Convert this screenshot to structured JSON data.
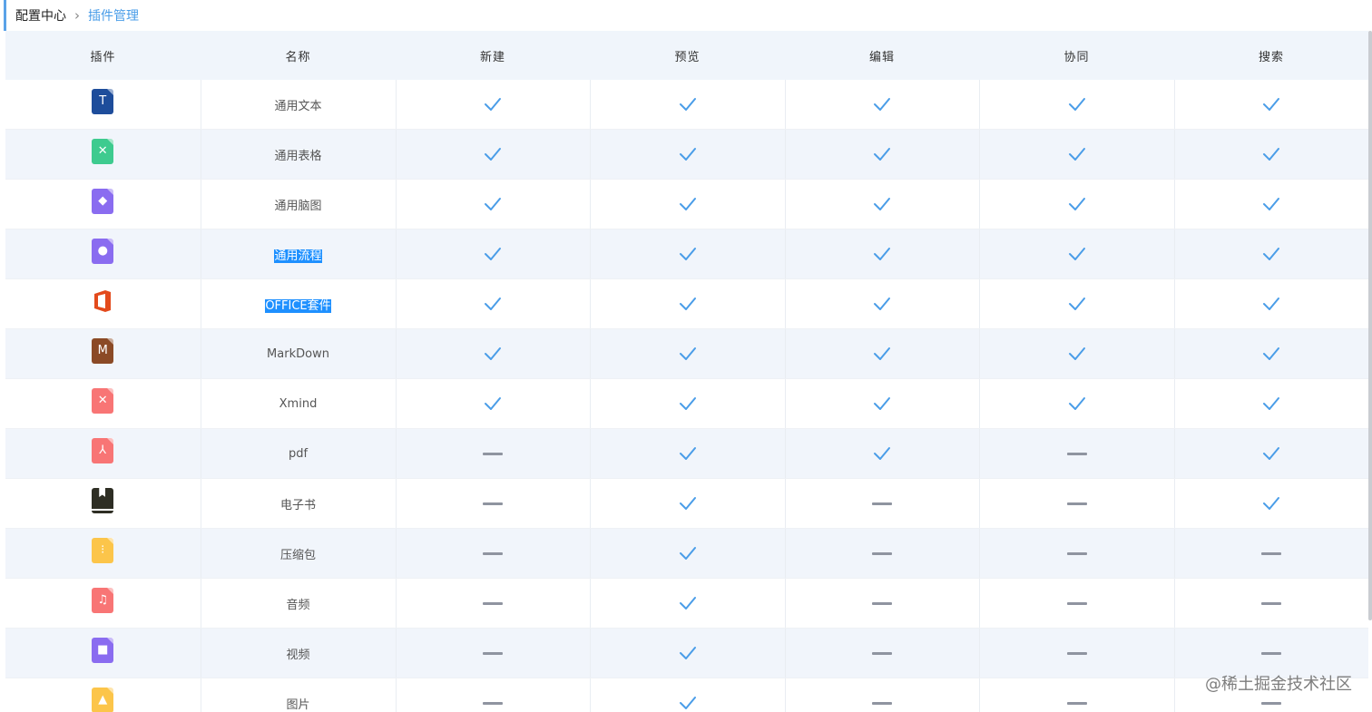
{
  "breadcrumb": {
    "root": "配置中心",
    "separator": "›",
    "current": "插件管理"
  },
  "table": {
    "columns": [
      "插件",
      "名称",
      "新建",
      "预览",
      "编辑",
      "协同",
      "搜索"
    ],
    "rows": [
      {
        "name": "通用文本",
        "icon": "text-doc-icon",
        "color": "#1e4d9b",
        "glyph": "T",
        "selected": false,
        "support": [
          true,
          true,
          true,
          true,
          true
        ]
      },
      {
        "name": "通用表格",
        "icon": "spreadsheet-icon",
        "color": "#3ecb8f",
        "glyph": "✕",
        "selected": false,
        "support": [
          true,
          true,
          true,
          true,
          true
        ]
      },
      {
        "name": "通用脑图",
        "icon": "mindmap-icon",
        "color": "#8a6cf0",
        "glyph": "◆",
        "selected": false,
        "support": [
          true,
          true,
          true,
          true,
          true
        ]
      },
      {
        "name": "通用流程",
        "icon": "flowchart-icon",
        "color": "#8a6cf0",
        "glyph": "●",
        "selected": true,
        "support": [
          true,
          true,
          true,
          true,
          true
        ]
      },
      {
        "name": "OFFICE套件",
        "icon": "office-icon",
        "color": "#e34a1c",
        "glyph": "",
        "selected": true,
        "support": [
          true,
          true,
          true,
          true,
          true
        ]
      },
      {
        "name": "MarkDown",
        "icon": "markdown-icon",
        "color": "#8b4a26",
        "glyph": "M",
        "selected": false,
        "support": [
          true,
          true,
          true,
          true,
          true
        ]
      },
      {
        "name": "Xmind",
        "icon": "xmind-icon",
        "color": "#f87575",
        "glyph": "✕",
        "selected": false,
        "support": [
          true,
          true,
          true,
          true,
          true
        ]
      },
      {
        "name": "pdf",
        "icon": "pdf-icon",
        "color": "#f87575",
        "glyph": "⅄",
        "selected": false,
        "support": [
          false,
          true,
          true,
          false,
          true
        ]
      },
      {
        "name": "电子书",
        "icon": "ebook-icon",
        "color": "#2e2e24",
        "glyph": "",
        "selected": false,
        "support": [
          false,
          true,
          false,
          false,
          true
        ]
      },
      {
        "name": "压缩包",
        "icon": "zip-icon",
        "color": "#fcc54a",
        "glyph": "⁝",
        "selected": false,
        "support": [
          false,
          true,
          false,
          false,
          false
        ]
      },
      {
        "name": "音频",
        "icon": "audio-icon",
        "color": "#f87575",
        "glyph": "♫",
        "selected": false,
        "support": [
          false,
          true,
          false,
          false,
          false
        ]
      },
      {
        "name": "视频",
        "icon": "video-icon",
        "color": "#8a6cf0",
        "glyph": "■",
        "selected": false,
        "support": [
          false,
          true,
          false,
          false,
          false
        ]
      },
      {
        "name": "图片",
        "icon": "image-icon",
        "color": "#fcc54a",
        "glyph": "▲",
        "selected": false,
        "support": [
          false,
          true,
          false,
          false,
          false
        ]
      }
    ]
  },
  "colors": {
    "check": "#4a9de8",
    "dash": "#8f94a0",
    "accent": "#4a9de8"
  },
  "watermark": "@稀土掘金技术社区"
}
